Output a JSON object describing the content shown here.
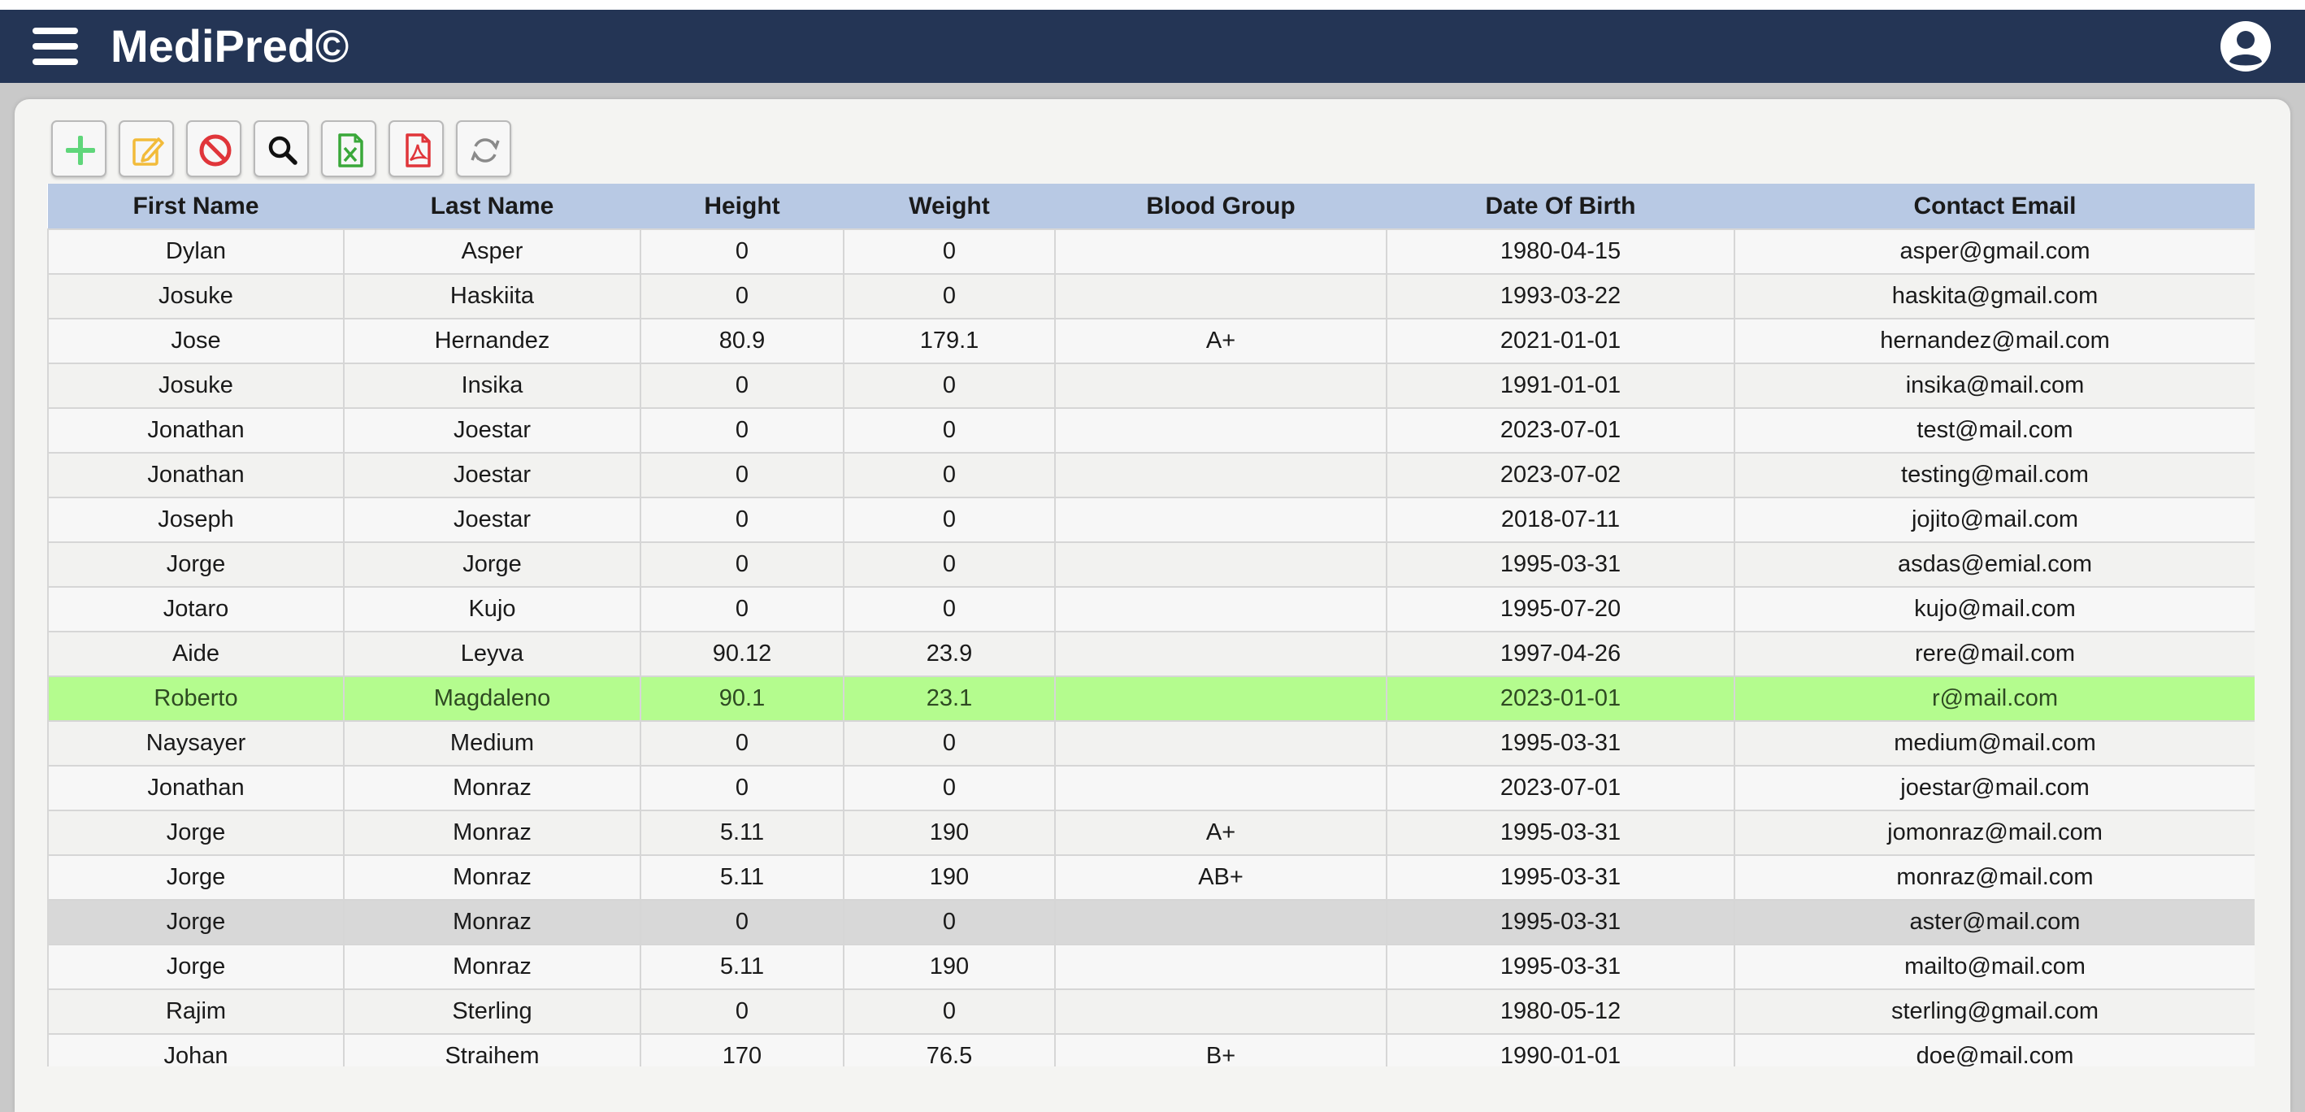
{
  "app": {
    "title": "MediPred©"
  },
  "toolbar": {
    "buttons": [
      {
        "name": "add-button",
        "icon": "plus-icon"
      },
      {
        "name": "edit-button",
        "icon": "edit-icon"
      },
      {
        "name": "delete-button",
        "icon": "prohibit-icon"
      },
      {
        "name": "search-button",
        "icon": "search-icon"
      },
      {
        "name": "export-excel-button",
        "icon": "excel-file-icon"
      },
      {
        "name": "export-pdf-button",
        "icon": "pdf-file-icon"
      },
      {
        "name": "refresh-button",
        "icon": "refresh-icon"
      }
    ]
  },
  "table": {
    "columns": [
      "First Name",
      "Last Name",
      "Height",
      "Weight",
      "Blood Group",
      "Date Of Birth",
      "Contact Email"
    ],
    "rows": [
      {
        "first": "Dylan",
        "last": "Asper",
        "height": "0",
        "weight": "0",
        "blood": "",
        "dob": "1980-04-15",
        "email": "asper@gmail.com"
      },
      {
        "first": "Josuke",
        "last": "Haskiita",
        "height": "0",
        "weight": "0",
        "blood": "",
        "dob": "1993-03-22",
        "email": "haskita@gmail.com"
      },
      {
        "first": "Jose",
        "last": "Hernandez",
        "height": "80.9",
        "weight": "179.1",
        "blood": "A+",
        "dob": "2021-01-01",
        "email": "hernandez@mail.com"
      },
      {
        "first": "Josuke",
        "last": "Insika",
        "height": "0",
        "weight": "0",
        "blood": "",
        "dob": "1991-01-01",
        "email": "insika@mail.com"
      },
      {
        "first": "Jonathan",
        "last": "Joestar",
        "height": "0",
        "weight": "0",
        "blood": "",
        "dob": "2023-07-01",
        "email": "test@mail.com"
      },
      {
        "first": "Jonathan",
        "last": "Joestar",
        "height": "0",
        "weight": "0",
        "blood": "",
        "dob": "2023-07-02",
        "email": "testing@mail.com"
      },
      {
        "first": "Joseph",
        "last": "Joestar",
        "height": "0",
        "weight": "0",
        "blood": "",
        "dob": "2018-07-11",
        "email": "jojito@mail.com"
      },
      {
        "first": "Jorge",
        "last": "Jorge",
        "height": "0",
        "weight": "0",
        "blood": "",
        "dob": "1995-03-31",
        "email": "asdas@emial.com"
      },
      {
        "first": "Jotaro",
        "last": "Kujo",
        "height": "0",
        "weight": "0",
        "blood": "",
        "dob": "1995-07-20",
        "email": "kujo@mail.com"
      },
      {
        "first": "Aide",
        "last": "Leyva",
        "height": "90.12",
        "weight": "23.9",
        "blood": "",
        "dob": "1997-04-26",
        "email": "rere@mail.com"
      },
      {
        "first": "Roberto",
        "last": "Magdaleno",
        "height": "90.1",
        "weight": "23.1",
        "blood": "",
        "dob": "2023-01-01",
        "email": "r@mail.com",
        "state": "selected"
      },
      {
        "first": "Naysayer",
        "last": "Medium",
        "height": "0",
        "weight": "0",
        "blood": "",
        "dob": "1995-03-31",
        "email": "medium@mail.com"
      },
      {
        "first": "Jonathan",
        "last": "Monraz",
        "height": "0",
        "weight": "0",
        "blood": "",
        "dob": "2023-07-01",
        "email": "joestar@mail.com"
      },
      {
        "first": "Jorge",
        "last": "Monraz",
        "height": "5.11",
        "weight": "190",
        "blood": "A+",
        "dob": "1995-03-31",
        "email": "jomonraz@mail.com"
      },
      {
        "first": "Jorge",
        "last": "Monraz",
        "height": "5.11",
        "weight": "190",
        "blood": "AB+",
        "dob": "1995-03-31",
        "email": "monraz@mail.com"
      },
      {
        "first": "Jorge",
        "last": "Monraz",
        "height": "0",
        "weight": "0",
        "blood": "",
        "dob": "1995-03-31",
        "email": "aster@mail.com",
        "state": "hover"
      },
      {
        "first": "Jorge",
        "last": "Monraz",
        "height": "5.11",
        "weight": "190",
        "blood": "",
        "dob": "1995-03-31",
        "email": "mailto@mail.com"
      },
      {
        "first": "Rajim",
        "last": "Sterling",
        "height": "0",
        "weight": "0",
        "blood": "",
        "dob": "1980-05-12",
        "email": "sterling@gmail.com"
      },
      {
        "first": "Johan",
        "last": "Straihem",
        "height": "170",
        "weight": "76.5",
        "blood": "B+",
        "dob": "1990-01-01",
        "email": "doe@mail.com"
      }
    ]
  },
  "colors": {
    "navbar": "#243555",
    "header_row": "#b8c9e4",
    "selected_row": "#b4fc8e",
    "hover_row": "#d8d8d8"
  }
}
